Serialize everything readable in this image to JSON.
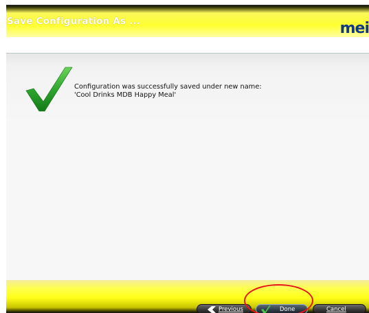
{
  "window": {
    "title": "Save Configuration As ...",
    "logo_text": "mei"
  },
  "content": {
    "message_line1": "Configuration was successfully saved under new name:",
    "message_line2": "'Cool Drinks MDB Happy Meal'"
  },
  "footer": {
    "previous_label": "Previous",
    "done_label": "Done",
    "cancel_label": "Cancel"
  },
  "colors": {
    "accent_yellow": "#ffff30",
    "check_green": "#2fa62f",
    "logo_blue": "#103a86",
    "highlight_red": "#e8141a"
  },
  "icons": {
    "success": "check-icon",
    "previous": "arrow-left-icon",
    "done": "check-icon"
  }
}
